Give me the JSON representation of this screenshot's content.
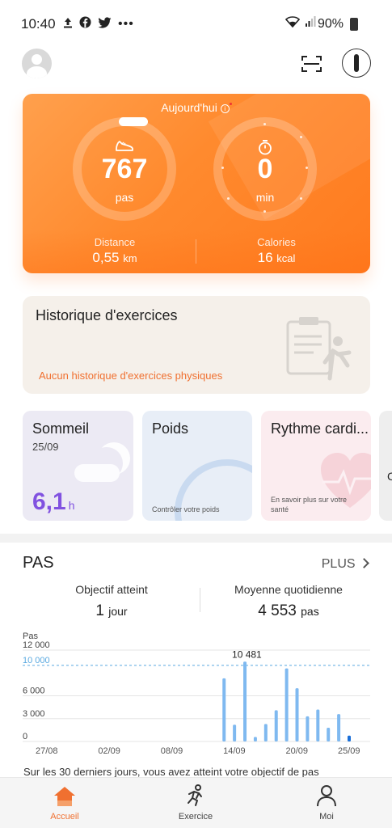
{
  "status_bar": {
    "time": "10:40",
    "left_icons": [
      "upload-icon",
      "facebook-icon",
      "twitter-icon",
      "more-dots-icon"
    ],
    "battery": "90%"
  },
  "today_card": {
    "title": "Aujourd'hui",
    "steps_value": "767",
    "steps_unit": "pas",
    "time_value": "0",
    "time_unit": "min",
    "distance_label": "Distance",
    "distance_value": "0,55",
    "distance_unit": "km",
    "calories_label": "Calories",
    "calories_value": "16",
    "calories_unit": "kcal",
    "accent": "#ff8a2e"
  },
  "history_card": {
    "title": "Historique d'exercices",
    "link": "Aucun historique d'exercices physiques"
  },
  "cards": {
    "sleep": {
      "title": "Sommeil",
      "date": "25/09",
      "value": "6,1",
      "unit": "h",
      "color": "#8152e0"
    },
    "weight": {
      "title": "Poids",
      "note": "Contrôler votre poids"
    },
    "heart": {
      "title": "Rythme cardi...",
      "note_line1": "En savoir plus sur votre",
      "note_line2": "santé"
    },
    "partial": {
      "glyph": "C"
    }
  },
  "steps_section": {
    "title": "PAS",
    "more": "PLUS",
    "goal_label": "Objectif atteint",
    "goal_value": "1",
    "goal_unit": "jour",
    "avg_label": "Moyenne quotidienne",
    "avg_value": "4 553",
    "avg_unit": "pas",
    "summary": "Sur les 30 derniers jours, vous avez atteint votre objectif de pas"
  },
  "chart_data": {
    "type": "bar",
    "ylabel": "Pas",
    "ylim": [
      0,
      12000
    ],
    "yticks": [
      "0",
      "3 000",
      "6 000",
      "10 000",
      "12 000"
    ],
    "goal_line": 10000,
    "x_tick_labels": [
      "27/08",
      "02/09",
      "08/09",
      "14/09",
      "20/09",
      "25/09"
    ],
    "peak_label": "10 481",
    "categories": [
      "13/09",
      "14/09",
      "15/09",
      "16/09",
      "17/09",
      "18/09",
      "19/09",
      "20/09",
      "21/09",
      "22/09",
      "23/09",
      "24/09",
      "25/09"
    ],
    "values": [
      8300,
      2200,
      10481,
      600,
      2300,
      4100,
      9600,
      7000,
      3300,
      4200,
      1800,
      3600,
      767
    ],
    "bar_color": "#7fb9f0",
    "today_color": "#1a6fd8"
  },
  "nav": {
    "home_label": "Accueil",
    "exercise_label": "Exercice",
    "me_label": "Moi",
    "active_color": "#f07030"
  }
}
